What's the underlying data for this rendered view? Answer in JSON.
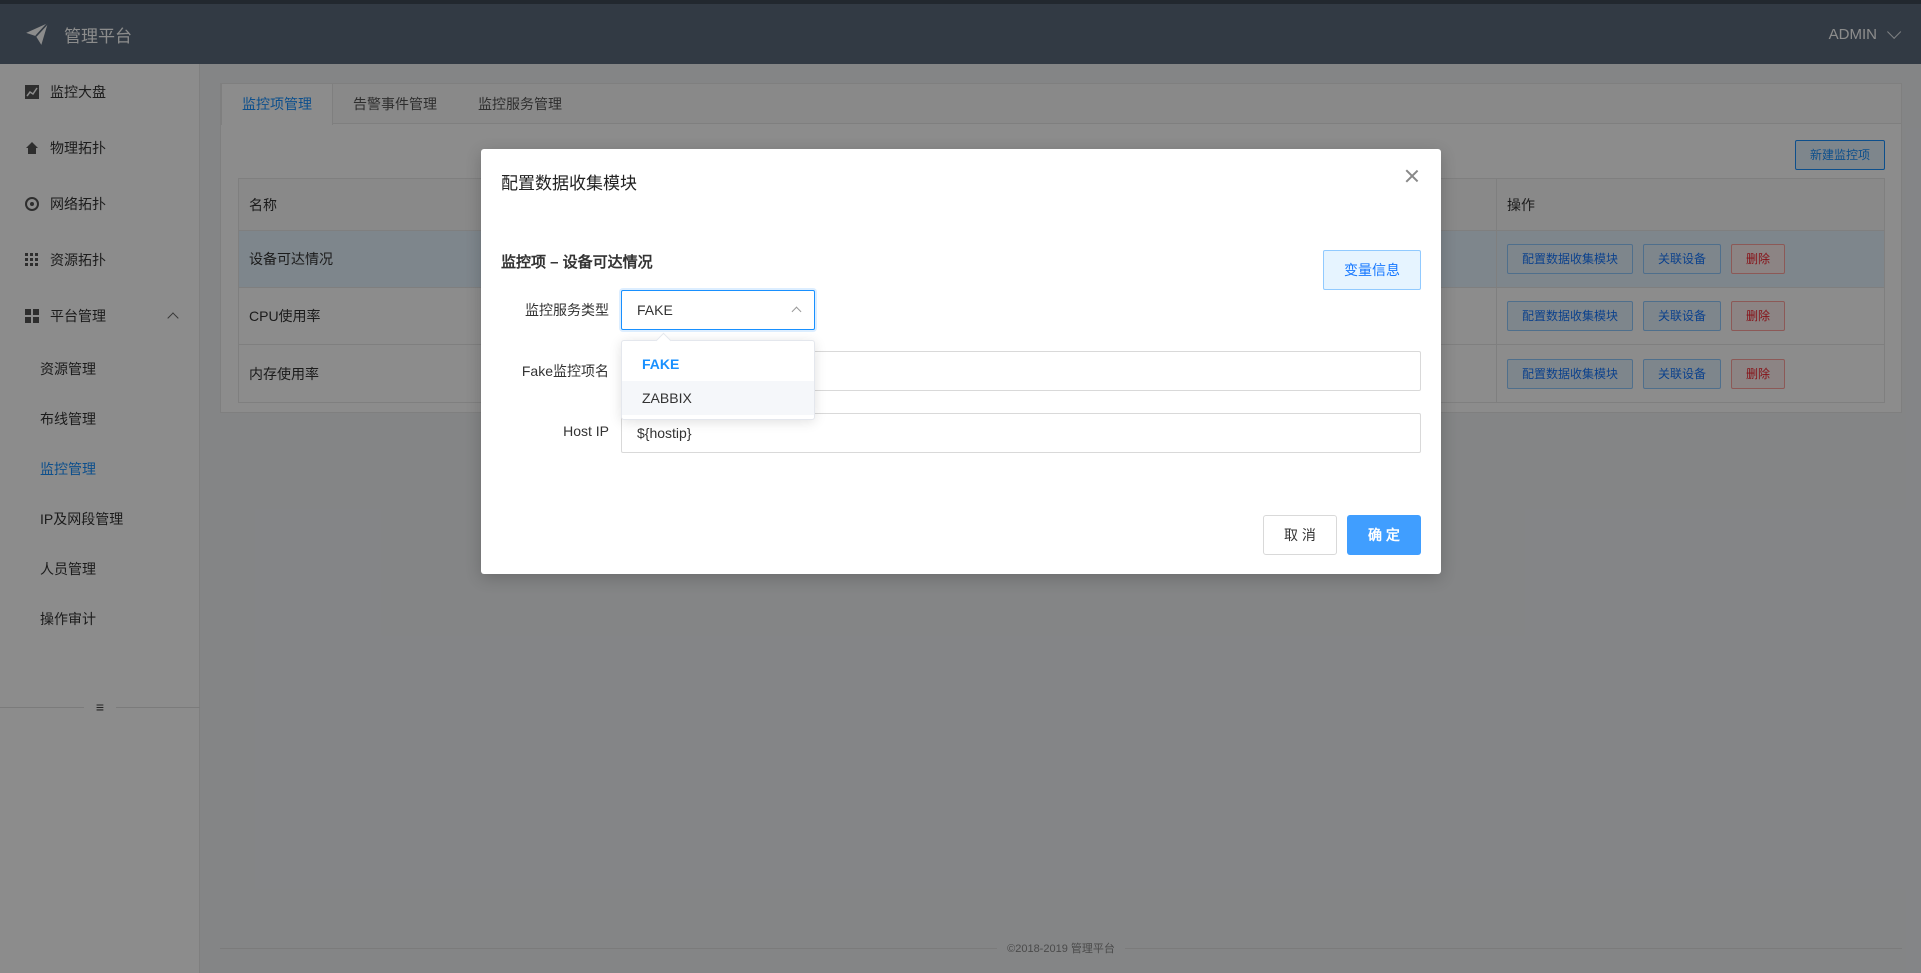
{
  "header": {
    "app_title": "管理平台",
    "user": "ADMIN"
  },
  "sidebar": {
    "items": [
      {
        "label": "监控大盘",
        "icon": "chart-icon"
      },
      {
        "label": "物理拓扑",
        "icon": "home-icon"
      },
      {
        "label": "网络拓扑",
        "icon": "network-icon"
      },
      {
        "label": "资源拓扑",
        "icon": "grid-icon"
      },
      {
        "label": "平台管理",
        "icon": "dashboard-icon"
      }
    ],
    "sub_items": [
      "资源管理",
      "布线管理",
      "监控管理",
      "IP及网段管理",
      "人员管理",
      "操作审计"
    ],
    "collapse": "≡"
  },
  "main": {
    "tabs": [
      "监控项管理",
      "告警事件管理",
      "监控服务管理"
    ],
    "new_button": "新建监控项",
    "table": {
      "col_name": "名称",
      "col_ops": "操作",
      "rows": [
        "设备可达情况",
        "CPU使用率",
        "内存使用率"
      ],
      "ops": {
        "config": "配置数据收集模块",
        "link": "关联设备",
        "delete": "删除"
      }
    }
  },
  "footer": {
    "text": "©2018-2019 管理平台"
  },
  "modal": {
    "title": "配置数据收集模块",
    "section": "监控项 – 设备可达情况",
    "var_button": "变量信息",
    "service_type_label": "监控服务类型",
    "service_type_value": "FAKE",
    "dropdown_options": [
      "FAKE",
      "ZABBIX"
    ],
    "fake_item_label": "Fake监控项名",
    "fake_item_value": "",
    "host_ip_label": "Host IP",
    "host_ip_value": "${hostip}",
    "cancel": "取 消",
    "ok": "确 定"
  },
  "colors": {
    "accent": "#1890ff",
    "header_bg": "#5c6b7c",
    "danger": "#f5222d"
  }
}
